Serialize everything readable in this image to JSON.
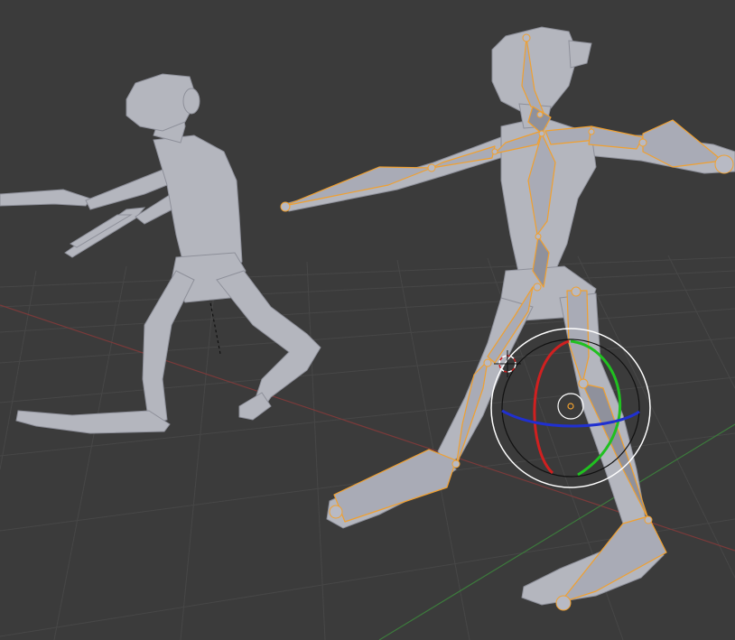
{
  "viewport": {
    "background": "#3b3b3b",
    "grid_color": "#474747",
    "axis_x_color": "#7a3a3a",
    "axis_y_color": "#3c7a3c"
  },
  "objects": {
    "left_character": {
      "mesh_color": "#b4b6be"
    },
    "right_character": {
      "mesh_color": "#b4b6be",
      "bone_outline_color": "#f0a030"
    }
  },
  "rotate_gizmo": {
    "x_ring_color": "#d02020",
    "y_ring_color": "#20c020",
    "z_ring_color": "#2030d0",
    "outer_ring_color": "#ffffff"
  },
  "cursor_3d": {
    "icon": "3d-cursor-icon",
    "ring_colors": [
      "#d02020",
      "#ffffff"
    ]
  }
}
